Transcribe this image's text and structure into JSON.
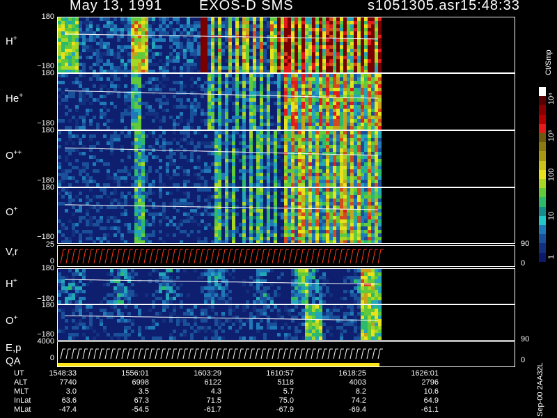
{
  "header": {
    "date": "May 13, 1991",
    "instrument": "EXOS-D SMS",
    "file": "s1051305.asr",
    "time": "15:48:33"
  },
  "panels": [
    {
      "label": "H",
      "charge": "+",
      "top": "180",
      "bottom": "−180"
    },
    {
      "label": "He",
      "charge": "+",
      "top": "180",
      "bottom": "−180"
    },
    {
      "label": "O",
      "charge": "++",
      "top": "180",
      "bottom": "−180"
    },
    {
      "label": "O",
      "charge": "+",
      "top": "180",
      "bottom": "−180"
    },
    {
      "label": "V,r",
      "charge": "",
      "top": "25",
      "bottom": "0",
      "right_top": "90",
      "right_bottom": "0"
    },
    {
      "label": "H",
      "charge": "+",
      "top": "180",
      "bottom": "−180"
    },
    {
      "label": "O",
      "charge": "+",
      "top": "180",
      "bottom": "−180"
    },
    {
      "label": "E,p",
      "label2": "QA",
      "charge": "",
      "top": "4000",
      "bottom": "0",
      "right_top": "90",
      "right_bottom": "0"
    }
  ],
  "colorbar": {
    "unit": "Ct/Smp",
    "labels": [
      "10⁴",
      "10³",
      "100",
      "10",
      "1"
    ]
  },
  "footer": {
    "rows": [
      {
        "label": "UT",
        "values": [
          "1548:33",
          "1556:01",
          "1603:29",
          "1610:57",
          "1618:25",
          "1626:01"
        ]
      },
      {
        "label": "ALT",
        "values": [
          "7740",
          "6998",
          "6122",
          "5118",
          "4003",
          "2796"
        ]
      },
      {
        "label": "MLT",
        "values": [
          "3.0",
          "3.5",
          "4.3",
          "5.7",
          "8.2",
          "10.6"
        ]
      },
      {
        "label": "InLat",
        "values": [
          "63.6",
          "67.3",
          "71.5",
          "75.0",
          "74.2",
          "64.9"
        ]
      },
      {
        "label": "MLat",
        "values": [
          "-47.4",
          "-54.5",
          "-61.7",
          "-67.9",
          "-69.4",
          "-61.1"
        ]
      }
    ],
    "side_text": "Sep-00 2AA32L"
  },
  "chart_data": {
    "type": "heatmap",
    "title": "May 13, 1991   EXOS-D SMS   s1051305.asr 15:48:33",
    "x_ticks_ut": [
      "1548:33",
      "1556:01",
      "1603:29",
      "1610:57",
      "1618:25",
      "1626:01"
    ],
    "y_range_pitch": [
      -180,
      180
    ],
    "colorbar_scale": "log",
    "colorbar_range": [
      1,
      10000
    ],
    "colorbar_unit": "Ct/Smp",
    "series": [
      {
        "name": "H+"
      },
      {
        "name": "He+"
      },
      {
        "name": "O++"
      },
      {
        "name": "O+"
      },
      {
        "name": "V,r"
      },
      {
        "name": "H+"
      },
      {
        "name": "O+"
      },
      {
        "name": "E,p"
      }
    ]
  }
}
